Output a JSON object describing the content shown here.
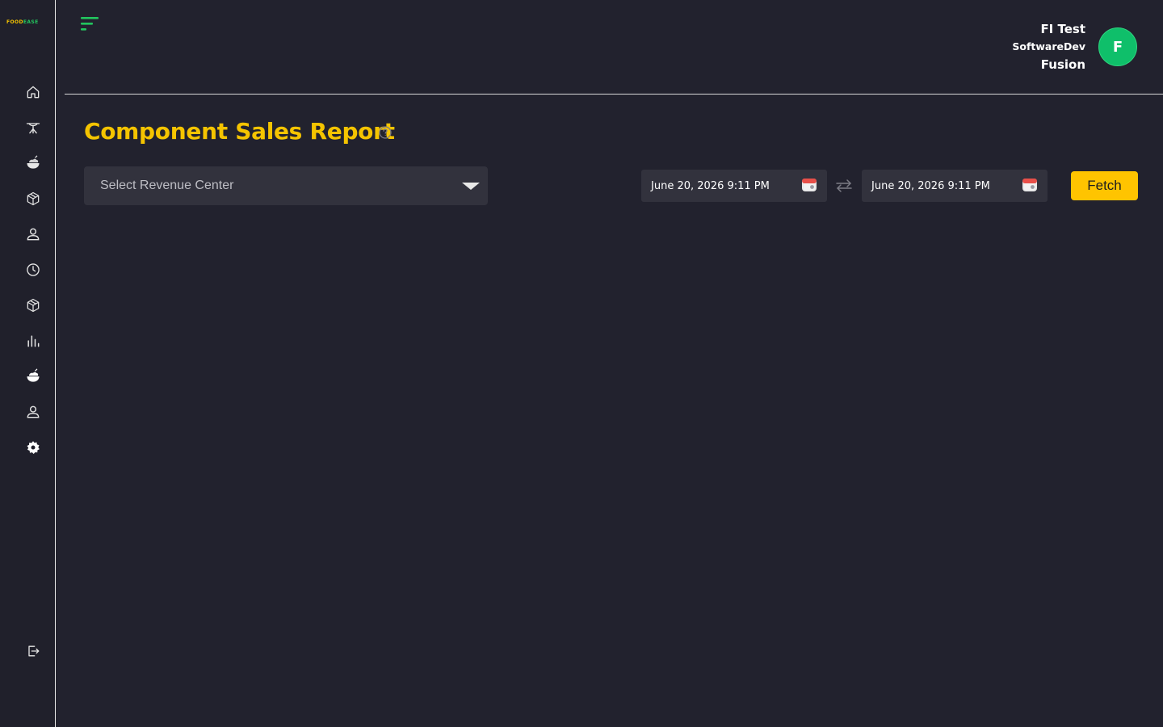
{
  "brand": {
    "logo_left": "FOOD",
    "logo_right": "EASE"
  },
  "sidebar": {
    "items": [
      {
        "icon": "home-icon",
        "top": 0
      },
      {
        "icon": "dining-table-icon"
      },
      {
        "icon": "food-bowl-icon"
      },
      {
        "icon": "package-icon"
      },
      {
        "icon": "user-icon"
      },
      {
        "icon": "clock-icon"
      },
      {
        "icon": "inventory-box-icon"
      },
      {
        "icon": "bar-chart-icon"
      },
      {
        "icon": "food-bowl-filled-icon"
      },
      {
        "icon": "customer-icon"
      },
      {
        "icon": "settings-gear-icon"
      }
    ],
    "logout_icon": "logout-icon"
  },
  "header": {
    "user_name": "FI Test",
    "user_org": "SoftwareDev",
    "user_company": "Fusion",
    "avatar_initial": "F"
  },
  "page": {
    "title": "Component Sales Report",
    "revenue_center_placeholder": "Select Revenue Center",
    "start_date": "June 20, 2026 9:11 PM",
    "end_date": "June 20, 2026 9:11 PM",
    "fetch_label": "Fetch"
  },
  "colors": {
    "background": "#22222e",
    "accent_yellow": "#f5c400",
    "accent_green": "#22c55e",
    "field_bg": "#32323d"
  }
}
